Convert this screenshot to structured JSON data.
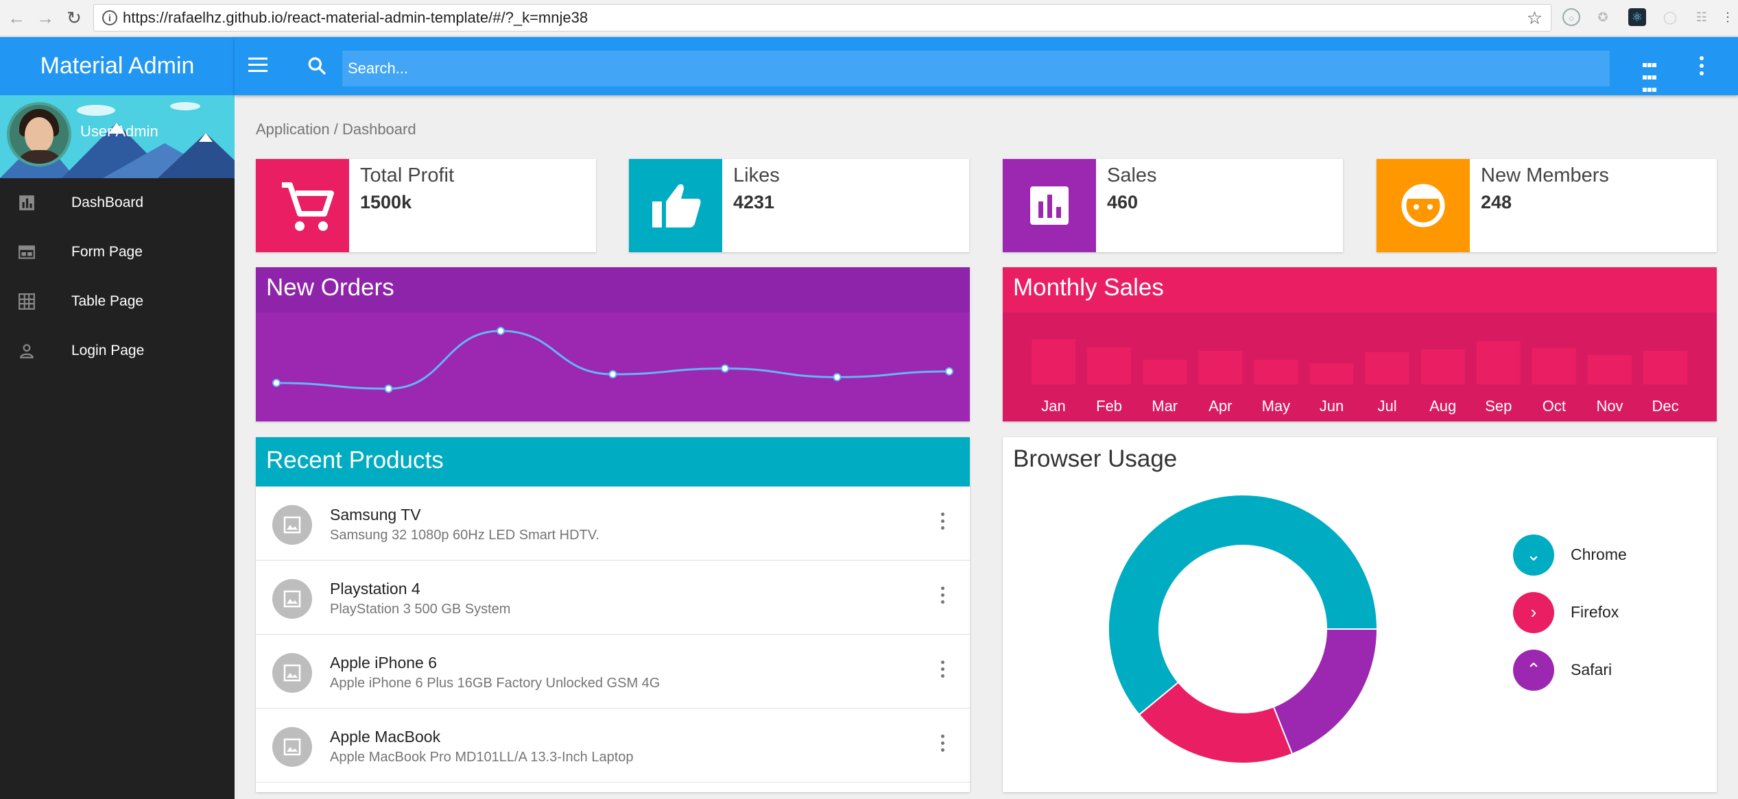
{
  "browser": {
    "url": "https://rafaelhz.github.io/react-material-admin-template/#/?_k=mnje38"
  },
  "app": {
    "title": "Material Admin",
    "search_placeholder": "Search..."
  },
  "user": {
    "name": "User Admin"
  },
  "sidebar": {
    "items": [
      {
        "label": "DashBoard",
        "icon": "bar-chart-icon"
      },
      {
        "label": "Form Page",
        "icon": "web-form-icon"
      },
      {
        "label": "Table Page",
        "icon": "grid-icon"
      },
      {
        "label": "Login Page",
        "icon": "person-icon"
      }
    ]
  },
  "breadcrumb": "Application / Dashboard",
  "stats": [
    {
      "title": "Total Profit",
      "value": "1500k",
      "color": "#e91e63",
      "icon": "cart-icon"
    },
    {
      "title": "Likes",
      "value": "4231",
      "color": "#00acc1",
      "icon": "thumb-up-icon"
    },
    {
      "title": "Sales",
      "value": "460",
      "color": "#9c27b0",
      "icon": "assessment-icon"
    },
    {
      "title": "New Members",
      "value": "248",
      "color": "#ff9800",
      "icon": "face-icon"
    }
  ],
  "new_orders": {
    "title": "New Orders"
  },
  "monthly_sales": {
    "title": "Monthly Sales"
  },
  "recent_products": {
    "title": "Recent Products",
    "items": [
      {
        "name": "Samsung TV",
        "desc": "Samsung 32 1080p 60Hz LED Smart HDTV."
      },
      {
        "name": "Playstation 4",
        "desc": "PlayStation 3 500 GB System"
      },
      {
        "name": "Apple iPhone 6",
        "desc": "Apple iPhone 6 Plus 16GB Factory Unlocked GSM 4G"
      },
      {
        "name": "Apple MacBook",
        "desc": "Apple MacBook Pro MD101LL/A 13.3-Inch Laptop"
      }
    ]
  },
  "browser_usage": {
    "title": "Browser Usage",
    "legend": [
      {
        "label": "Chrome",
        "color": "#00acc1",
        "glyph": "⌄"
      },
      {
        "label": "Firefox",
        "color": "#e91e63",
        "glyph": "›"
      },
      {
        "label": "Safari",
        "color": "#9c27b0",
        "glyph": "⌃"
      }
    ]
  },
  "chart_data": [
    {
      "type": "line",
      "x": [
        1,
        2,
        3,
        4,
        5,
        6,
        7
      ],
      "values": [
        5,
        4,
        14,
        6.5,
        7.5,
        6,
        7
      ],
      "ylim": [
        0,
        16
      ],
      "grid": false,
      "color": "#64b5f6"
    },
    {
      "type": "bar",
      "categories": [
        "Jan",
        "Feb",
        "Mar",
        "Apr",
        "May",
        "Jun",
        "Jul",
        "Aug",
        "Sep",
        "Oct",
        "Nov",
        "Dec"
      ],
      "values": [
        6.6,
        5.4,
        3.6,
        4.9,
        3.6,
        3.1,
        4.7,
        5.1,
        6.3,
        5.3,
        4.3,
        4.9
      ],
      "ylim": [
        0,
        10
      ],
      "grid": false
    },
    {
      "type": "pie",
      "labels": [
        "Chrome",
        "Firefox",
        "Safari"
      ],
      "values": [
        61,
        20,
        19
      ],
      "colors": [
        "#00acc1",
        "#e91e63",
        "#9c27b0"
      ]
    }
  ]
}
